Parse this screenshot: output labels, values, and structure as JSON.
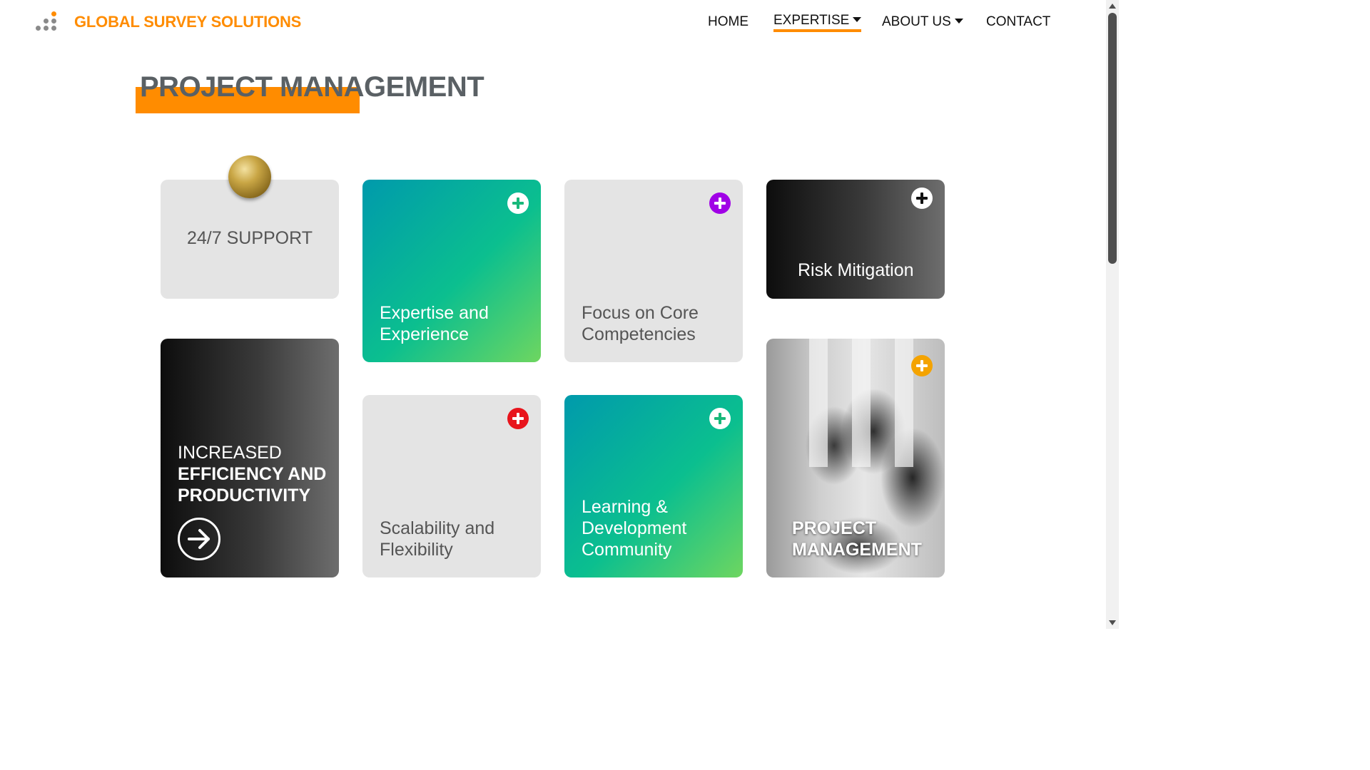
{
  "header": {
    "brand": "GLOBAL SURVEY SOLUTIONS",
    "logo_icon": "dots-logo-icon",
    "accent_color": "#ff8c00",
    "nav": [
      {
        "label": "HOME",
        "dropdown": false,
        "active": false
      },
      {
        "label": "EXPERTISE",
        "dropdown": true,
        "active": true
      },
      {
        "label": "ABOUT US",
        "dropdown": true,
        "active": false
      },
      {
        "label": "CONTACT",
        "dropdown": false,
        "active": false
      }
    ]
  },
  "page": {
    "title": "PROJECT MANAGEMENT"
  },
  "cards": {
    "support": {
      "label": "24/7 SUPPORT",
      "icon": "gold-ball-icon"
    },
    "expertise": {
      "line1": "Expertise and",
      "line2": "Experience",
      "icon": "plus-circle-icon",
      "icon_color": "#19b87a"
    },
    "focus": {
      "line1": "Focus on Core",
      "line2": "Competencies",
      "icon": "plus-circle-icon",
      "icon_color": "#a000e6"
    },
    "risk": {
      "label": "Risk Mitigation",
      "icon": "plus-circle-icon",
      "icon_color": "#ffffff"
    },
    "efficiency": {
      "line1": "INCREASED",
      "line2": "EFFICIENCY AND",
      "line3": "PRODUCTIVITY",
      "icon": "arrow-right-circle-icon"
    },
    "scalability": {
      "line1": "Scalability and",
      "line2": "Flexibility",
      "icon": "plus-circle-icon",
      "icon_color": "#e8141c"
    },
    "learning": {
      "line1": "Learning &",
      "line2": "Development",
      "line3": "Community",
      "icon": "plus-circle-icon",
      "icon_color": "#19b87a"
    },
    "project": {
      "line1": "PROJECT",
      "line2": "MANAGEMENT",
      "icon": "plus-circle-icon",
      "icon_color": "#f4a300"
    }
  }
}
